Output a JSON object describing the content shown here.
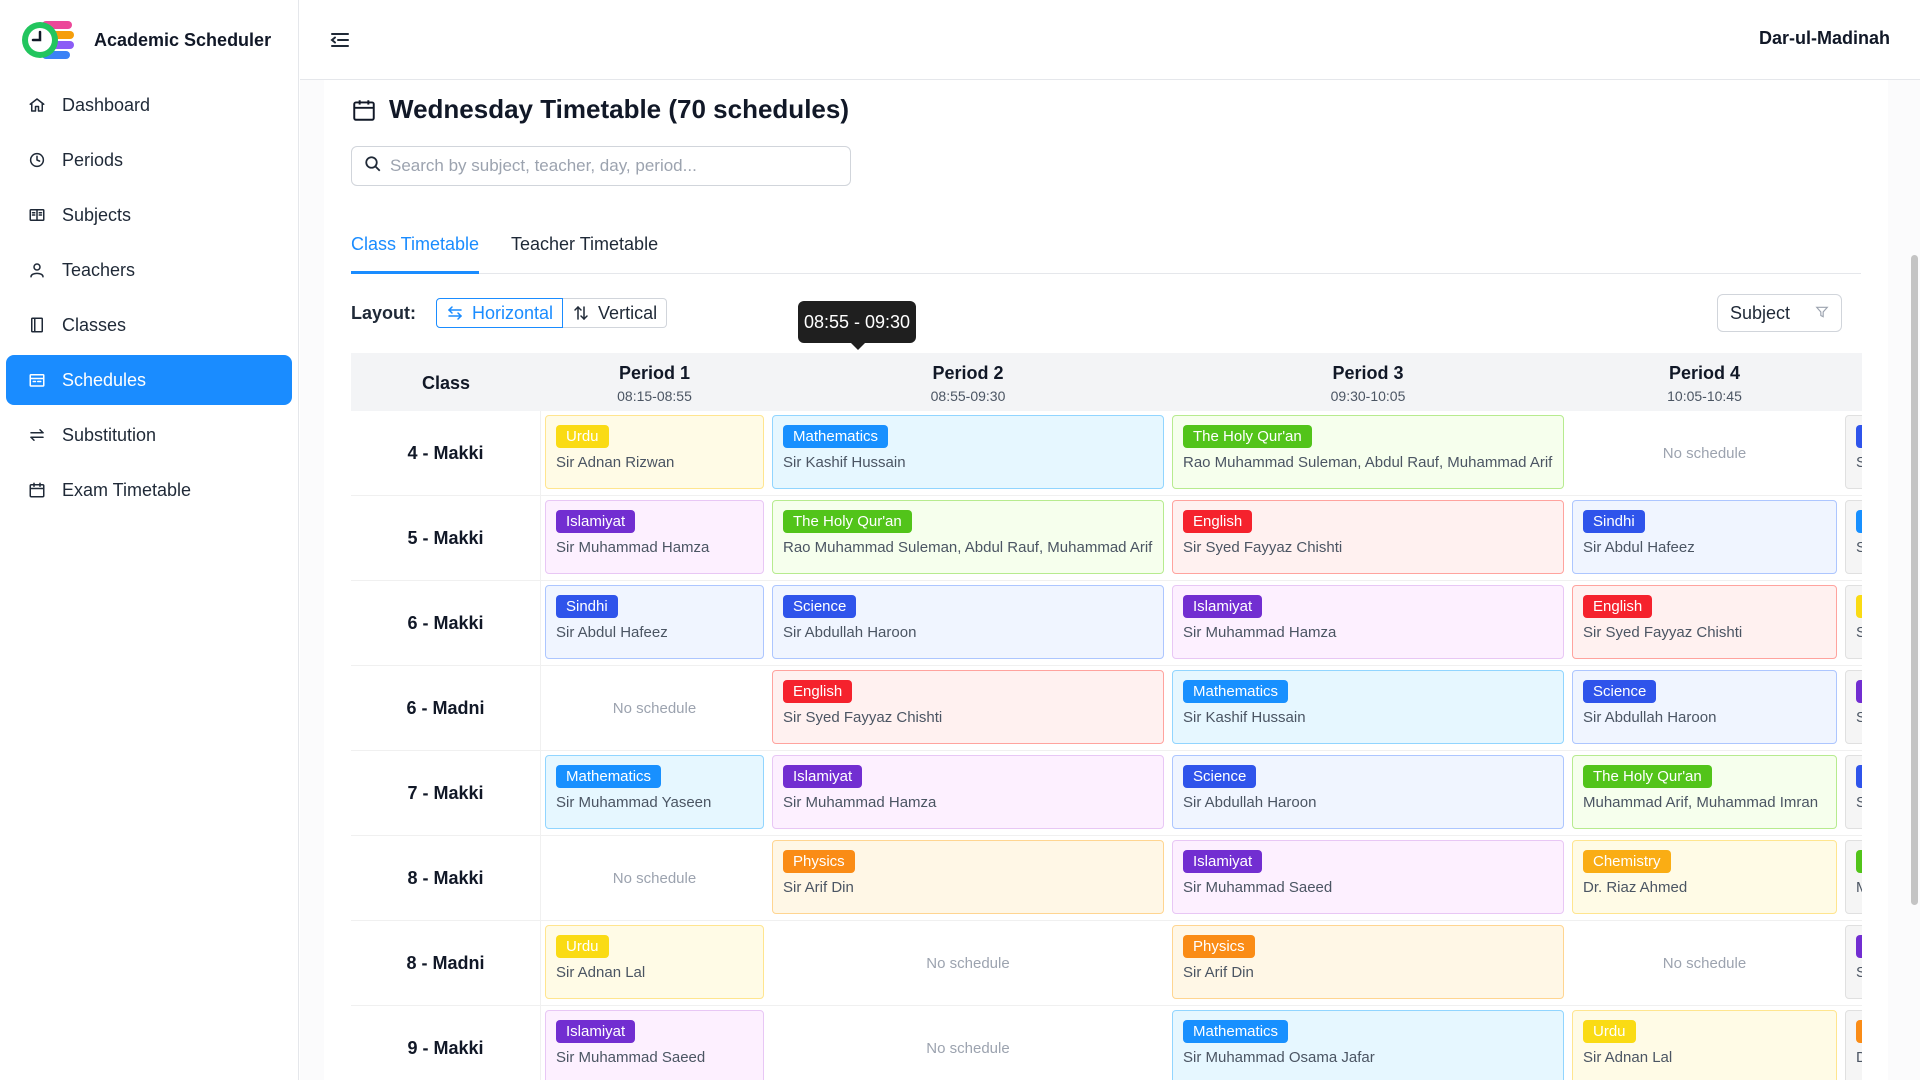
{
  "app": {
    "title": "Academic Scheduler",
    "org": "Dar-ul-Madinah"
  },
  "sidebar": {
    "items": [
      {
        "label": "Dashboard",
        "icon": "home-icon"
      },
      {
        "label": "Periods",
        "icon": "clock-icon"
      },
      {
        "label": "Subjects",
        "icon": "book-icon"
      },
      {
        "label": "Teachers",
        "icon": "user-icon"
      },
      {
        "label": "Classes",
        "icon": "notebook-icon"
      },
      {
        "label": "Schedules",
        "icon": "schedule-icon",
        "active": true
      },
      {
        "label": "Substitution",
        "icon": "swap-icon"
      },
      {
        "label": "Exam Timetable",
        "icon": "calendar-icon"
      }
    ]
  },
  "page": {
    "title": "Wednesday Timetable (70 schedules)",
    "search_placeholder": "Search by subject, teacher, day, period...",
    "tabs": [
      "Class Timetable",
      "Teacher Timetable"
    ],
    "active_tab": 0,
    "layout_label": "Layout:",
    "layout_options": [
      "Horizontal",
      "Vertical"
    ],
    "layout_selected": "Horizontal",
    "filter_label": "Subject",
    "tooltip": "08:55 - 09:30"
  },
  "colors": {
    "accent": "#1a8cff",
    "Urdu": {
      "tag": "#fadb14",
      "bg": "#fffbe6",
      "border": "#ffe58f"
    },
    "Mathematics": {
      "tag": "#1890ff",
      "bg": "#e6f7ff",
      "border": "#91d5ff"
    },
    "The Holy Qur'an": {
      "tag": "#52c41a",
      "bg": "#f6ffed",
      "border": "#b7eb8f"
    },
    "Islamiyat": {
      "tag": "#722ed1",
      "bg": "#fdf0ff",
      "border": "#e8c7f5"
    },
    "English": {
      "tag": "#f5222d",
      "bg": "#fff1f0",
      "border": "#ffa39e"
    },
    "Sindhi": {
      "tag": "#2f54eb",
      "bg": "#f0f5ff",
      "border": "#adc6ff"
    },
    "Science": {
      "tag": "#2f54eb",
      "bg": "#f0f5ff",
      "border": "#adc6ff"
    },
    "Physics": {
      "tag": "#fa8c16",
      "bg": "#fff7e6",
      "border": "#ffd591"
    },
    "Chemistry": {
      "tag": "#faad14",
      "bg": "#fffbe6",
      "border": "#ffe58f"
    }
  },
  "timetable": {
    "class_header": "Class",
    "periods": [
      {
        "name": "Period 1",
        "time": "08:15-08:55"
      },
      {
        "name": "Period 2",
        "time": "08:55-09:30"
      },
      {
        "name": "Period 3",
        "time": "09:30-10:05"
      },
      {
        "name": "Period 4",
        "time": "10:05-10:45"
      }
    ],
    "empty_label": "No schedule",
    "rows": [
      {
        "class": "4 - Makki",
        "cells": [
          {
            "subject": "Urdu",
            "teacher": "Sir Adnan Rizwan"
          },
          {
            "subject": "Mathematics",
            "teacher": "Sir Kashif Hussain"
          },
          {
            "subject": "The Holy Qur'an",
            "teacher": "Rao Muhammad Suleman, Abdul Rauf, Muhammad Arif"
          },
          null,
          {
            "subject": "S",
            "tag": "#2f54eb",
            "teacher": "Si"
          }
        ]
      },
      {
        "class": "5 - Makki",
        "cells": [
          {
            "subject": "Islamiyat",
            "teacher": "Sir Muhammad Hamza"
          },
          {
            "subject": "The Holy Qur'an",
            "teacher": "Rao Muhammad Suleman, Abdul Rauf, Muhammad Arif"
          },
          {
            "subject": "English",
            "teacher": "Sir Syed Fayyaz Chishti"
          },
          {
            "subject": "Sindhi",
            "teacher": "Sir Abdul Hafeez"
          },
          {
            "subject": "M",
            "tag": "#1890ff",
            "teacher": "Si"
          }
        ]
      },
      {
        "class": "6 - Makki",
        "cells": [
          {
            "subject": "Sindhi",
            "teacher": "Sir Abdul Hafeez"
          },
          {
            "subject": "Science",
            "teacher": "Sir Abdullah Haroon"
          },
          {
            "subject": "Islamiyat",
            "teacher": "Sir Muhammad Hamza"
          },
          {
            "subject": "English",
            "teacher": "Sir Syed Fayyaz Chishti"
          },
          {
            "subject": "U",
            "tag": "#fadb14",
            "teacher": "Si"
          }
        ]
      },
      {
        "class": "6 - Madni",
        "cells": [
          null,
          {
            "subject": "English",
            "teacher": "Sir Syed Fayyaz Chishti"
          },
          {
            "subject": "Mathematics",
            "teacher": "Sir Kashif Hussain"
          },
          {
            "subject": "Science",
            "teacher": "Sir Abdullah Haroon"
          },
          {
            "subject": "I",
            "tag": "#722ed1",
            "teacher": "Si"
          }
        ]
      },
      {
        "class": "7 - Makki",
        "cells": [
          {
            "subject": "Mathematics",
            "teacher": "Sir Muhammad Yaseen"
          },
          {
            "subject": "Islamiyat",
            "teacher": "Sir Muhammad Hamza"
          },
          {
            "subject": "Science",
            "teacher": "Sir Abdullah Haroon"
          },
          {
            "subject": "The Holy Qur'an",
            "teacher": "Muhammad Arif, Muhammad Imran"
          },
          {
            "subject": "S",
            "tag": "#2f54eb",
            "teacher": "Si"
          }
        ]
      },
      {
        "class": "8 - Makki",
        "cells": [
          null,
          {
            "subject": "Physics",
            "teacher": "Sir Arif Din"
          },
          {
            "subject": "Islamiyat",
            "teacher": "Sir Muhammad Saeed"
          },
          {
            "subject": "Chemistry",
            "teacher": "Dr. Riaz Ahmed"
          },
          {
            "subject": "T",
            "tag": "#52c41a",
            "teacher": "M"
          }
        ]
      },
      {
        "class": "8 - Madni",
        "cells": [
          {
            "subject": "Urdu",
            "teacher": "Sir Adnan Lal"
          },
          null,
          {
            "subject": "Physics",
            "teacher": "Sir Arif Din"
          },
          null,
          {
            "subject": "I",
            "tag": "#722ed1",
            "teacher": "Si"
          }
        ]
      },
      {
        "class": "9 - Makki",
        "cells": [
          {
            "subject": "Islamiyat",
            "teacher": "Sir Muhammad Saeed"
          },
          null,
          {
            "subject": "Mathematics",
            "teacher": "Sir Muhammad Osama Jafar"
          },
          {
            "subject": "Urdu",
            "teacher": "Sir Adnan Lal"
          },
          {
            "subject": "C",
            "tag": "#fa8c16",
            "teacher": "Dr"
          }
        ]
      }
    ]
  }
}
